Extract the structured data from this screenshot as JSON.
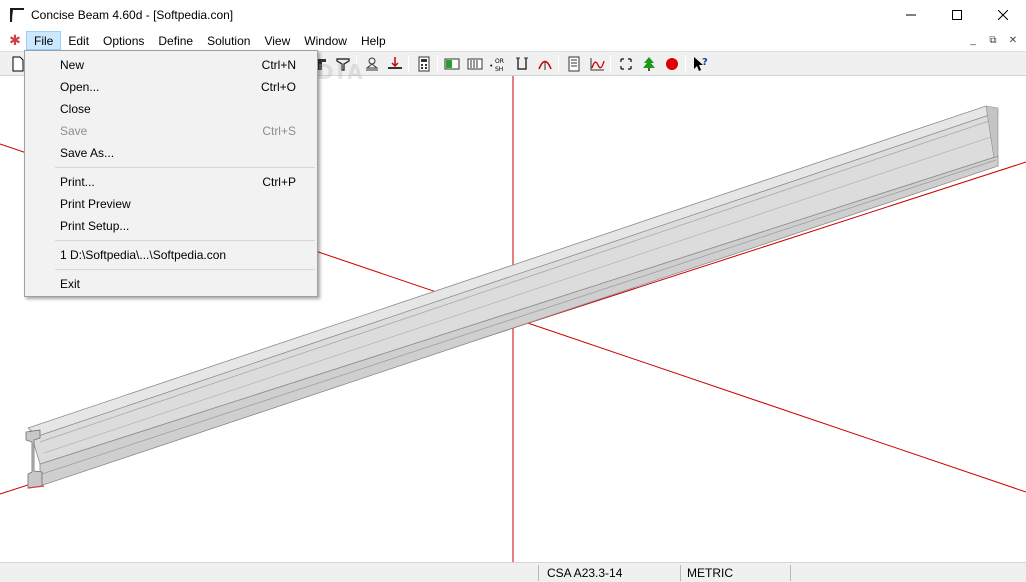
{
  "window": {
    "title": "Concise Beam 4.60d - [Softpedia.con]",
    "controls": {
      "minimize": "—",
      "maximize": "☐",
      "close": "✕"
    }
  },
  "menubar": {
    "system_icon": "✱",
    "items": [
      "File",
      "Edit",
      "Options",
      "Define",
      "Solution",
      "View",
      "Window",
      "Help"
    ],
    "active": "File",
    "mdi_controls": [
      "_",
      "⧉",
      "✕"
    ]
  },
  "file_menu": {
    "items": [
      {
        "label": "New",
        "shortcut": "Ctrl+N",
        "enabled": true
      },
      {
        "label": "Open...",
        "shortcut": "Ctrl+O",
        "enabled": true
      },
      {
        "label": "Close",
        "shortcut": "",
        "enabled": true
      },
      {
        "label": "Save",
        "shortcut": "Ctrl+S",
        "enabled": false
      },
      {
        "label": "Save As...",
        "shortcut": "",
        "enabled": true
      },
      {
        "label": "Print...",
        "shortcut": "Ctrl+P",
        "enabled": true
      },
      {
        "label": "Print Preview",
        "shortcut": "",
        "enabled": true
      },
      {
        "label": "Print Setup...",
        "shortcut": "",
        "enabled": true
      },
      {
        "label": "1 D:\\Softpedia\\...\\Softpedia.con",
        "shortcut": "",
        "enabled": true
      },
      {
        "label": "Exit",
        "shortcut": "",
        "enabled": true
      }
    ]
  },
  "toolbar": {
    "icons": [
      "new-file-icon",
      "section-t-icon",
      "section-y-icon",
      "support-icon",
      "load-icon",
      "calculator-icon",
      "flexure-icon",
      "shear-icon",
      "or-sh-icon",
      "stirrup-icon",
      "deflection-icon",
      "report-icon",
      "diagram-icon",
      "move-icon",
      "tree-icon",
      "stop-icon",
      "help-pointer-icon"
    ],
    "colors": {
      "axis": "#cc0000",
      "beam_fill": "#d9d9d9",
      "beam_edge": "#8c8c8c"
    }
  },
  "watermark": "SOFTPEDIA",
  "statusbar": {
    "code": "CSA A23.3-14",
    "units": "METRIC"
  }
}
